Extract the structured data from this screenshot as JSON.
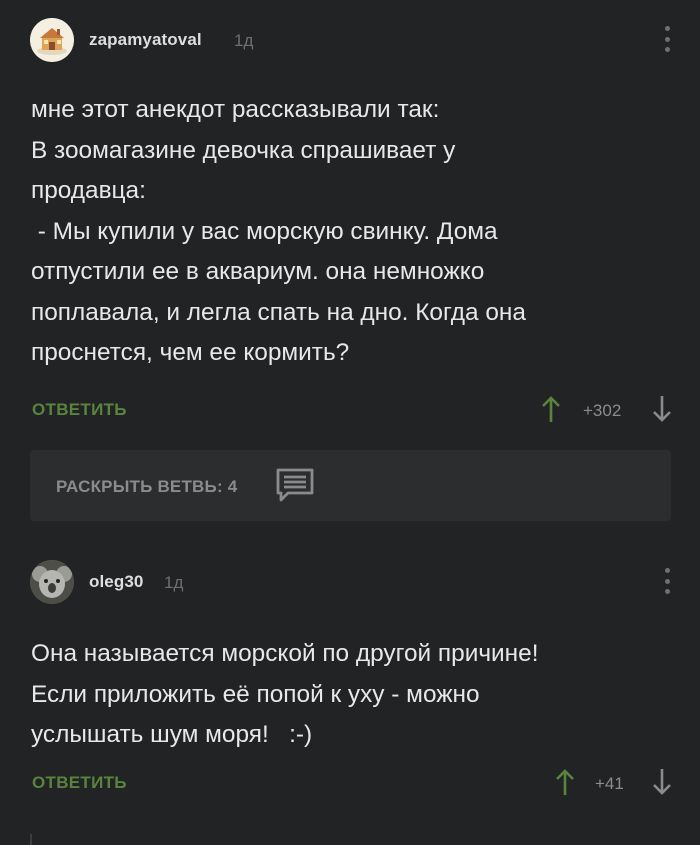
{
  "comments": [
    {
      "username": "zapamyatoval",
      "time": "1д",
      "avatar_icon": "house-drawing-avatar-icon",
      "lines": [
        "мне этот анекдот рассказывали так:",
        "В зоомагазине девочка спрашивает у",
        "продавца:",
        " - Мы купили у вас морскую свинку. Дома",
        "отпустили ее в аквариум. она немножко",
        "поплавала, и легла спать на дно. Когда она",
        "проснется, чем ее кормить?"
      ],
      "reply_label": "ОТВЕТИТЬ",
      "rating": "+302"
    },
    {
      "username": "oleg30",
      "time": "1д",
      "avatar_icon": "koala-avatar-icon",
      "lines": [
        "Она называется морской по другой причине!",
        "Если приложить её попой к уху - можно",
        "услышать шум моря!   :-)"
      ],
      "reply_label": "ОТВЕТИТЬ",
      "rating": "+41"
    }
  ],
  "expand_thread": {
    "label": "РАСКРЫТЬ ВЕТВЬ: 4",
    "icon": "comment-lines-icon"
  },
  "colors": {
    "background": "#222324",
    "accent_green": "#58843e",
    "text": "#e8e8e8",
    "muted": "#8a8b8d",
    "panel": "#2c2d2f"
  },
  "icons": {
    "more": "kebab-menu-icon",
    "vote_up": "arrow-up-icon",
    "vote_down": "arrow-down-icon"
  }
}
